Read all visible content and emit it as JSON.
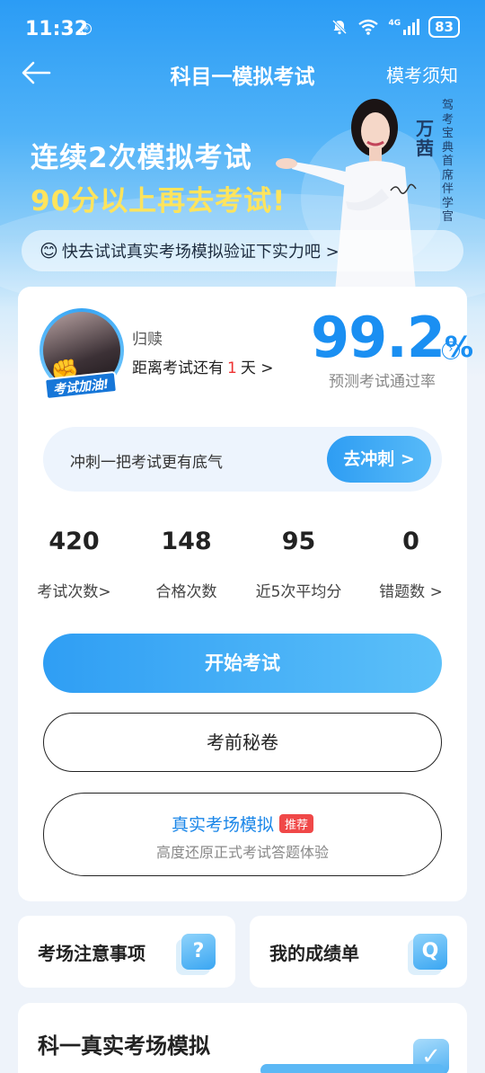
{
  "status_bar": {
    "time": "11:32",
    "battery": "83",
    "network": "4G"
  },
  "nav": {
    "title": "科目一模拟考试",
    "right_link": "模考须知"
  },
  "banner": {
    "slogan_line1": "连续2次模拟考试",
    "slogan_line2": "90分以上再去考试!",
    "person_name": "万茜",
    "person_title": "驾考宝典首席伴学官",
    "prompt": "快去试试真实考场模拟验证下实力吧 >"
  },
  "profile": {
    "avatar_badge": "考试加油!",
    "user_name": "归赎",
    "countdown_prefix": "距离考试还有",
    "countdown_days": "1",
    "countdown_suffix": "天 >",
    "pass_rate": "99.2",
    "pass_rate_unit": "%",
    "pass_rate_label": "预测考试通过率"
  },
  "sprint": {
    "text": "冲刺一把考试更有底气",
    "button": "去冲刺 >"
  },
  "stats": [
    {
      "value": "420",
      "label": "考试次数>"
    },
    {
      "value": "148",
      "label": "合格次数"
    },
    {
      "value": "95",
      "label": "近5次平均分"
    },
    {
      "value": "0",
      "label": "错题数 >"
    }
  ],
  "actions": {
    "start": "开始考试",
    "secret": "考前秘卷",
    "real_title": "真实考场模拟",
    "real_tag": "推荐",
    "real_subtitle": "高度还原正式考试答题体验"
  },
  "tiles": {
    "notice": "考场注意事项",
    "report": "我的成绩单"
  },
  "bottom": {
    "title": "科一真实考场模拟"
  },
  "colors": {
    "primary": "#1a8ff2",
    "slogan_highlight": "#ffe45c",
    "countdown_highlight": "#e33333",
    "tag_red": "#f04848"
  }
}
